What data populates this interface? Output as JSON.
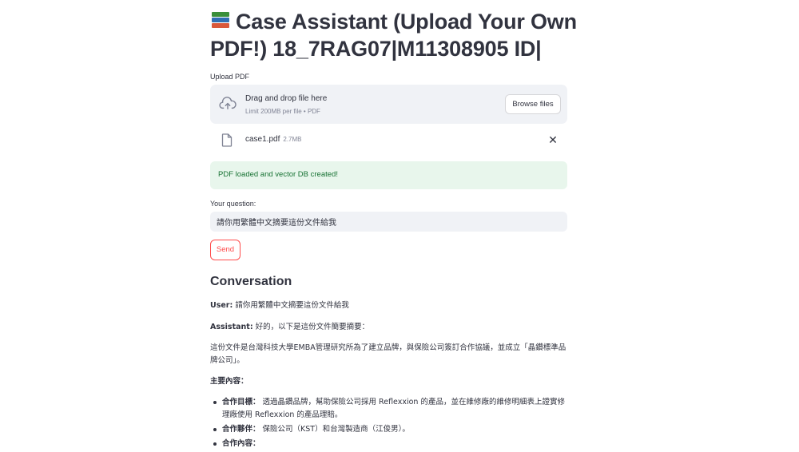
{
  "title": "Case Assistant (Upload Your Own PDF!) 18_7RAG07|M11308905 ID|",
  "title_icon": "books-icon",
  "upload": {
    "label": "Upload PDF",
    "drop_text": "Drag and drop file here",
    "limit_text": "Limit 200MB per file • PDF",
    "browse_label": "Browse files",
    "file": {
      "name": "case1.pdf",
      "size": "2.7MB"
    }
  },
  "status": {
    "message": "PDF loaded and vector DB created!"
  },
  "question": {
    "label": "Your question:",
    "value": "請你用繁體中文摘要這份文件給我",
    "send_label": "Send"
  },
  "conversation": {
    "heading": "Conversation",
    "user_label": "User:",
    "user_text": " 請你用繁體中文摘要這份文件給我",
    "assistant_label": "Assistant:",
    "assistant_text": " 好的，以下是這份文件簡要摘要：",
    "summary": "這份文件是台灣科技大學EMBA管理研究所為了建立品牌，與保險公司簽訂合作協議，並成立「晶鑽標準品牌公司」。",
    "main_heading": "主要內容：",
    "bullets": [
      {
        "label": "合作目標：",
        "text": " 透過晶鑽品牌，幫助保險公司採用 Reflexxion 的產品，並在維修廠的維修明細表上證實修理廠使用 Reflexxion 的產品理賠。"
      },
      {
        "label": "合作夥伴：",
        "text": " 保險公司（KST）和台灣製造商（江俊男）。"
      },
      {
        "label": "合作內容：",
        "text": ""
      }
    ]
  },
  "colors": {
    "text": "#31333f",
    "accent": "#ff4b4b",
    "success_bg": "#e8f6ec",
    "success_text": "#177233",
    "input_bg": "#f0f2f6"
  }
}
